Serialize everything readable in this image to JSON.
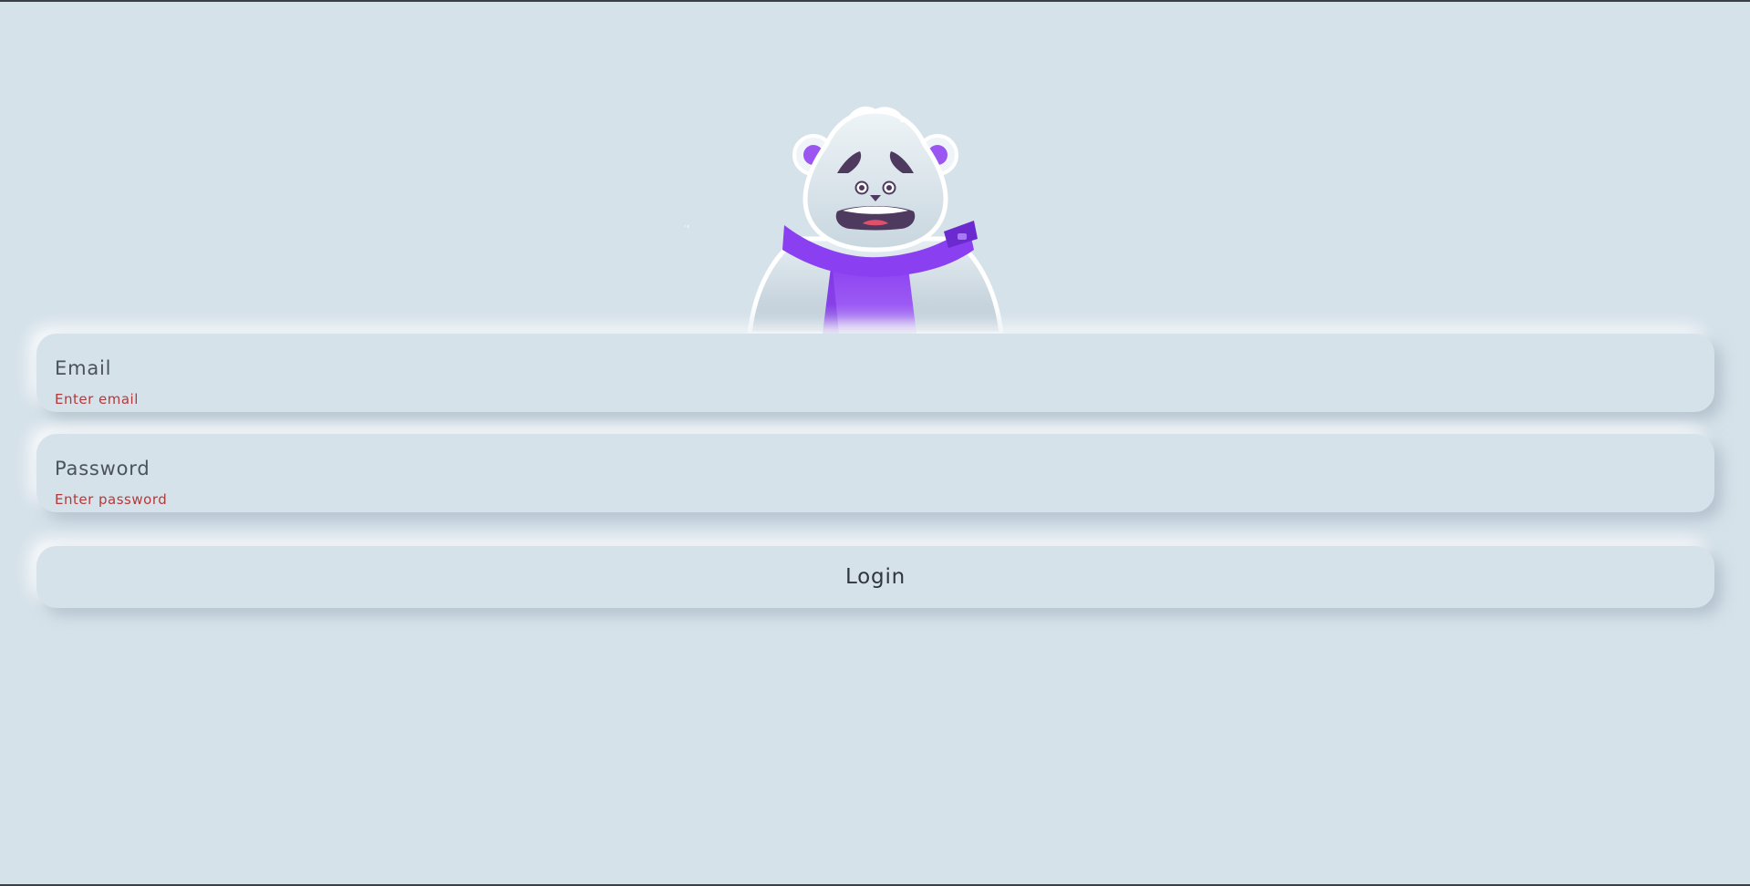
{
  "login_form": {
    "email": {
      "placeholder": "Email",
      "value": "",
      "error": "Enter email"
    },
    "password": {
      "placeholder": "Password",
      "value": "",
      "error": "Enter password"
    },
    "login_label": "Login"
  },
  "mascot": {
    "icon": "polar-bear-mascot-icon",
    "expression": "worried",
    "scarf_color": "#8a3ff0",
    "fur_color": "#dfe9ef",
    "eyebrow_color": "#4e3a5e"
  },
  "colors": {
    "background": "#d6e2ea",
    "error": "#b33a3a",
    "text": "#2f363c"
  }
}
